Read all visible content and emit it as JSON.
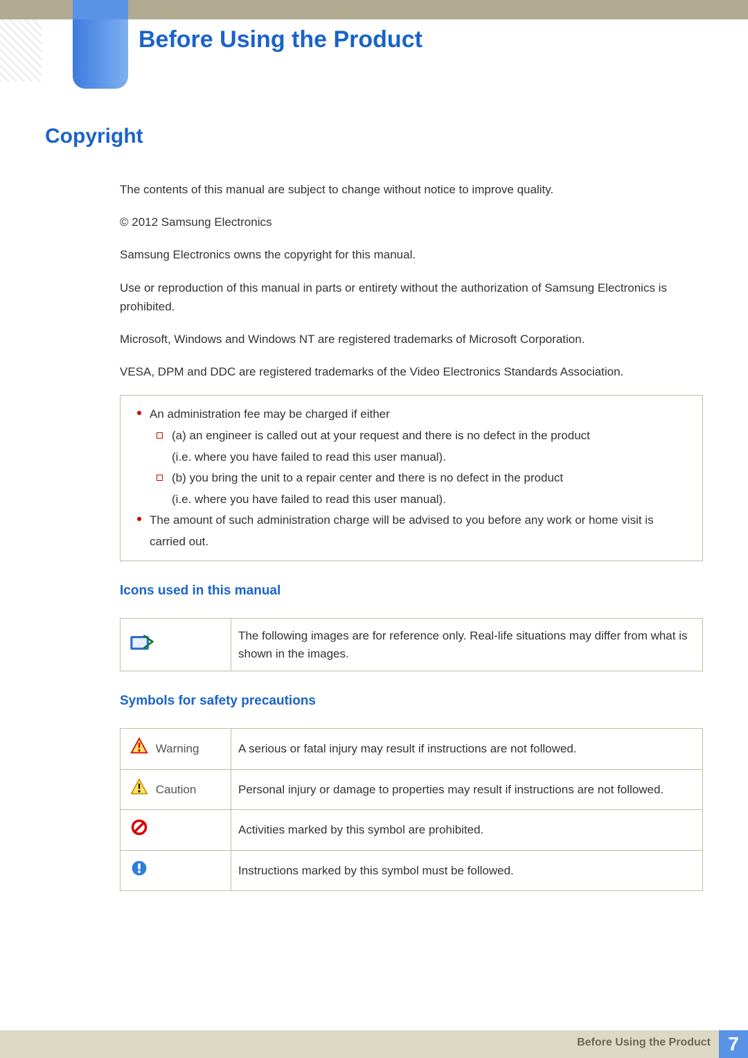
{
  "chapter_title": "Before Using the Product",
  "section_title": "Copyright",
  "paragraphs": [
    "The contents of this manual are subject to change without notice to improve quality.",
    "© 2012 Samsung Electronics",
    "Samsung Electronics owns the copyright for this manual.",
    "Use or reproduction of this manual in parts or entirety without the authorization of Samsung Electronics is prohibited.",
    "Microsoft, Windows and Windows NT are registered trademarks of Microsoft Corporation.",
    "VESA, DPM and DDC are registered trademarks of the Video Electronics Standards Association."
  ],
  "admin_box": {
    "item1": "An administration fee may be charged if either",
    "item1_a": "(a) an engineer is called out at your request and there is no defect in the product",
    "item1_a_sub": "(i.e. where you have failed to read this user manual).",
    "item1_b": "(b) you bring the unit to a repair center and there is no defect in the product",
    "item1_b_sub": "(i.e. where you have failed to read this user manual).",
    "item2": "The amount of such administration charge will be advised to you before any work or home visit is carried out."
  },
  "icons_section_title": "Icons used in this manual",
  "icons_table": {
    "row1_desc": "The following images are for reference only. Real-life situations may differ from what is shown in the images."
  },
  "symbols_section_title": "Symbols for safety precautions",
  "symbols_table": {
    "warning_label": "Warning",
    "warning_desc": "A serious or fatal injury may result if instructions are not followed.",
    "caution_label": "Caution",
    "caution_desc": "Personal injury or damage to properties may result if instructions are not followed.",
    "prohibited_desc": "Activities marked by this symbol are prohibited.",
    "mustfollow_desc": "Instructions marked by this symbol must be followed."
  },
  "footer_title": "Before Using the Product",
  "footer_page": "7"
}
